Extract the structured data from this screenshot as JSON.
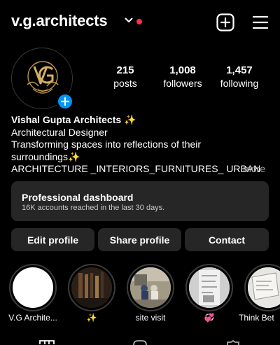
{
  "header": {
    "username": "v.g.architects"
  },
  "profile": {
    "avatar_icon": "vg-monogram-logo",
    "stats": [
      {
        "value": "215",
        "label": "posts"
      },
      {
        "value": "1,008",
        "label": "followers"
      },
      {
        "value": "1,457",
        "label": "following"
      }
    ]
  },
  "bio": {
    "name": "Vishal Gupta Architects ✨",
    "category": "Architectural Designer",
    "line1": "Transforming spaces into reflections of their",
    "line2": "surroundings✨",
    "line3": "ARCHITECTURE _INTERIORS_FURNITURES_ URBAN",
    "more": "more"
  },
  "dashboard": {
    "title": "Professional dashboard",
    "subtitle": "16K accounts reached in the last 30 days."
  },
  "actions": {
    "edit": "Edit profile",
    "share": "Share profile",
    "contact": "Contact"
  },
  "highlights": [
    {
      "label": "V.G Archite..."
    },
    {
      "label": "✨"
    },
    {
      "label": "site visit"
    },
    {
      "label": "💞"
    },
    {
      "label": "Think Bet"
    }
  ],
  "colors": {
    "accent": "#0095f6",
    "notification": "#ff3040",
    "surface": "#262626"
  }
}
